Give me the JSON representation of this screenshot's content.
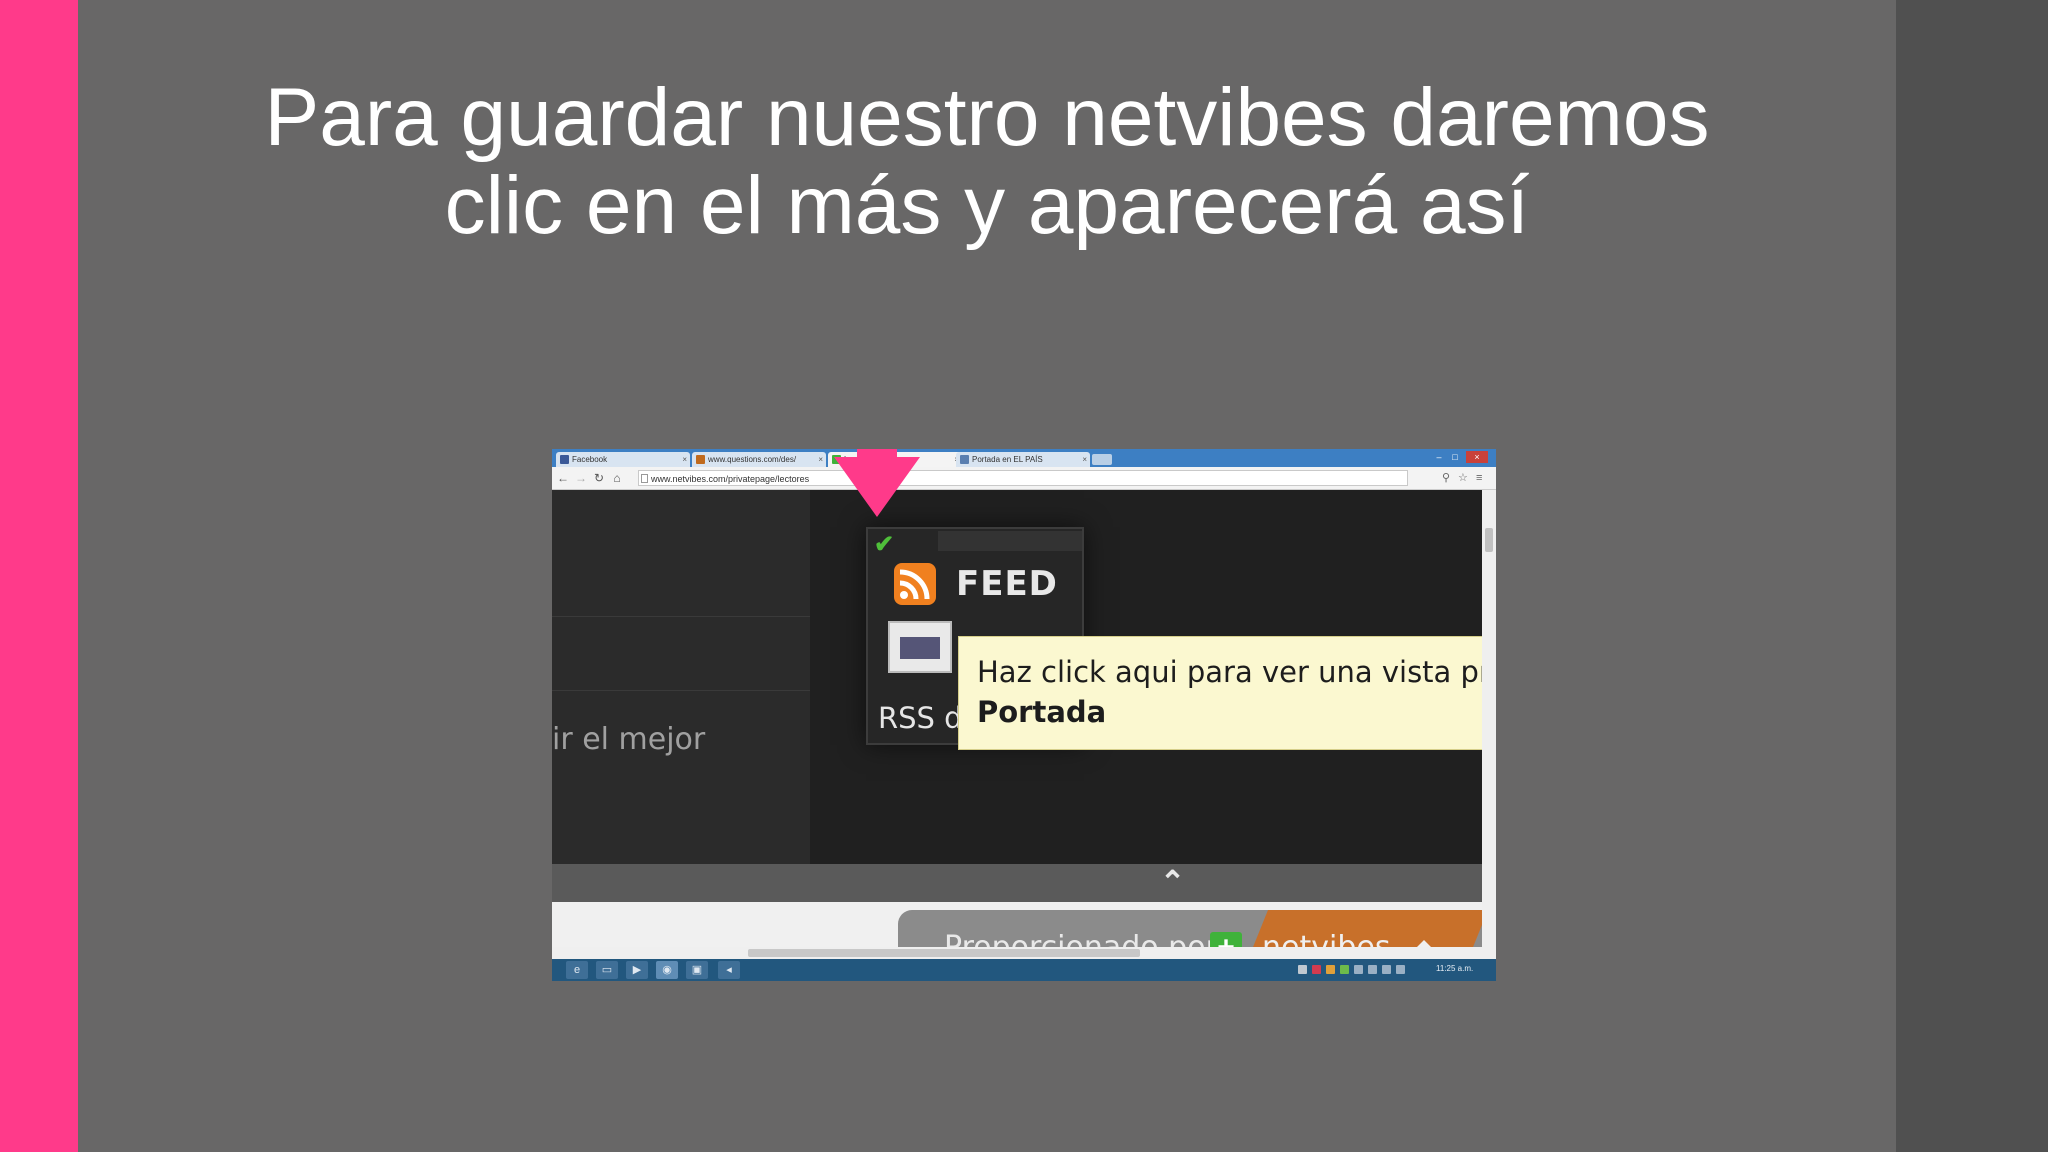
{
  "slide": {
    "title_line1": "Para guardar nuestro netvibes daremos",
    "title_line2": "clic en el más y aparecerá así",
    "colors": {
      "background": "#686767",
      "accent_bar": "#ff3a8a",
      "right_band": "#505050"
    }
  },
  "browser": {
    "tabs": [
      {
        "label": "Facebook",
        "favicon_color": "#3b5998"
      },
      {
        "label": "www.questions.com/des/",
        "favicon_color": "#c06a1d"
      },
      {
        "label": "Lecto",
        "favicon_color": "#3fb23a"
      },
      {
        "label": "Portada en EL PAÍS",
        "favicon_color": "#5a7fb0"
      }
    ],
    "url": "www.netvibes.com/privatepage/lectores"
  },
  "netvibes": {
    "left_text": "ir el mejor",
    "feed_label": "FEED",
    "rss_caption": "RSS de la secc",
    "tooltip_line1": "Haz click aqui para ver una vista previ",
    "tooltip_line2": "Portada",
    "provided_by": "Proporcionado por",
    "brand": "netvibes"
  },
  "taskbar": {
    "clock": "11:25 a.m."
  }
}
